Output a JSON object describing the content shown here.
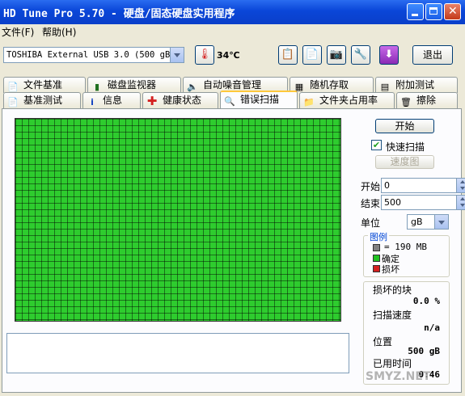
{
  "window": {
    "title": "HD Tune Pro 5.70 - 硬盘/固态硬盘实用程序"
  },
  "menu": {
    "file": "文件(F)",
    "help": "帮助(H)"
  },
  "toolbar": {
    "drive": "TOSHIBA External USB 3.0 (500 gB)",
    "temperature": "34℃",
    "exit_label": "退出",
    "icons": [
      "copy-icon",
      "paste-icon",
      "camera-icon",
      "settings-icon",
      "download-icon"
    ]
  },
  "tabs_top": [
    "文件基准",
    "磁盘监视器",
    "自动噪音管理",
    "随机存取",
    "附加测试"
  ],
  "tabs_bottom": [
    "基准测试",
    "信息",
    "健康状态",
    "错误扫描",
    "文件夹占用率",
    "擦除"
  ],
  "active_tab": "错误扫描",
  "scan": {
    "start_button": "开始",
    "quick_scan_label": "快速扫描",
    "quick_scan_checked": true,
    "speed_map_button": "速度图",
    "start_label": "开始",
    "start_value": "0",
    "end_label": "结束",
    "end_value": "500",
    "unit_label": "单位",
    "unit_value": "gB",
    "block_fraction_ok": 1.0
  },
  "legend": {
    "title": "图例",
    "block_size": "= 190 MB",
    "ok": "确定",
    "damaged": "损坏",
    "colors": {
      "block": "#808080",
      "ok": "#22c322",
      "damaged": "#d42020",
      "grid": "#2ecc2e"
    }
  },
  "stats": {
    "damaged_label": "损坏的块",
    "damaged_value": "0.0 %",
    "speed_label": "扫描速度",
    "speed_value": "n/a",
    "position_label": "位置",
    "position_value": "500 gB",
    "elapsed_label": "已用时间",
    "elapsed_value": "0:46"
  },
  "watermark": "SMYZ.NET"
}
